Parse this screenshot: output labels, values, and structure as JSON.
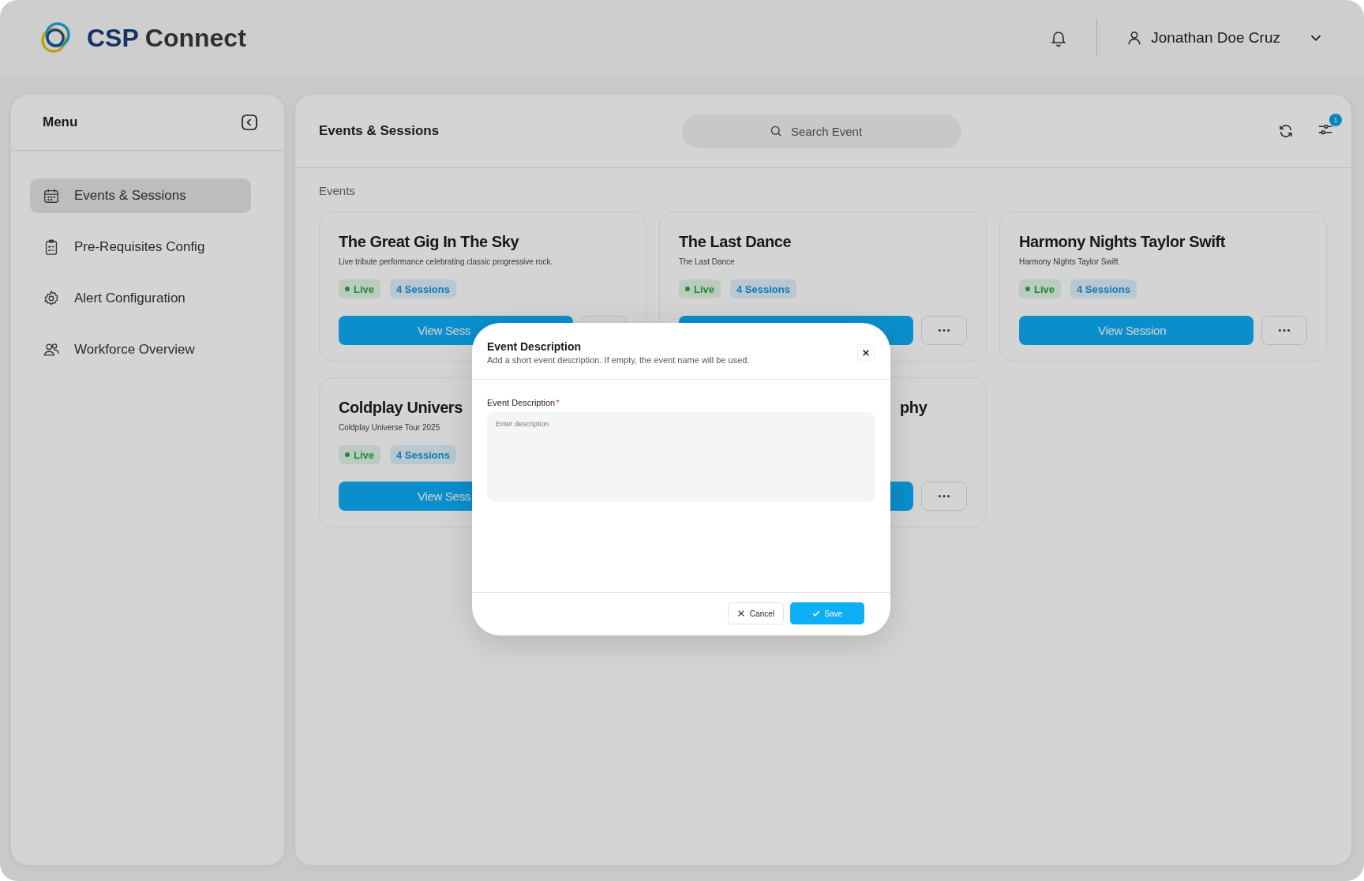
{
  "header": {
    "logo": {
      "accent": "CSP",
      "name": "Connect"
    },
    "user": {
      "name": "Jonathan Doe Cruz"
    }
  },
  "sidebar": {
    "title": "Menu",
    "items": [
      {
        "label": "Events & Sessions",
        "selected": true
      },
      {
        "label": "Pre-Requisites Config",
        "selected": false
      },
      {
        "label": "Alert Configuration",
        "selected": false
      },
      {
        "label": "Workforce Overview",
        "selected": false
      }
    ]
  },
  "main": {
    "title": "Events & Sessions",
    "search": {
      "placeholder": "Search Event"
    },
    "filter_badge": "1",
    "section_label": "Events",
    "cards": [
      {
        "kind": "full",
        "title": "The Great Gig In The Sky",
        "subtitle": "Live tribute performance celebrating classic progressive rock.",
        "status": "Live",
        "sessions": "4 Sessions",
        "button": "View Sess"
      },
      {
        "kind": "full",
        "title": "The Last Dance",
        "subtitle": "The Last Dance",
        "status": "Live",
        "sessions": "4 Sessions"
      },
      {
        "kind": "full",
        "title": "Harmony Nights Taylor Swift",
        "subtitle": "Harmony Nights Taylor Swift",
        "status": "Live",
        "sessions": "4 Sessions",
        "button": "View Session"
      },
      {
        "kind": "clipped",
        "title": "Coldplay Univers",
        "subtitle": "Coldplay Universe Tour 2025",
        "status": "Live",
        "sessions": "4 Sessions",
        "button": "View Sess"
      },
      {
        "kind": "covered",
        "title": "phy"
      }
    ]
  },
  "modal": {
    "title": "Event Description",
    "subtitle": "Add a short event description. If empty, the event name will be used.",
    "field_label": "Event Description",
    "required_mark": "*",
    "placeholder": "Enter description",
    "cancel": "Cancel",
    "save": "Save"
  }
}
